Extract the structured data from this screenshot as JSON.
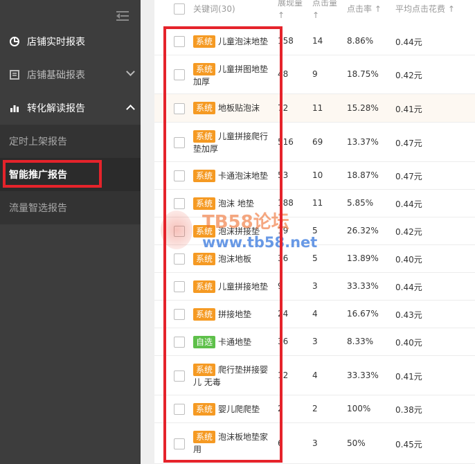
{
  "sidebar": {
    "items": [
      {
        "label": "店铺实时报表",
        "icon": "pie-chart-icon"
      },
      {
        "label": "店铺基础报表",
        "icon": "report-icon",
        "chevron": "down"
      },
      {
        "label": "转化解读报告",
        "icon": "bar-chart-icon",
        "chevron": "up"
      }
    ],
    "sub_items": [
      {
        "label": "定时上架报告",
        "active": false
      },
      {
        "label": "智能推广报告",
        "active": true
      },
      {
        "label": "流量智选报告",
        "active": false
      }
    ]
  },
  "table": {
    "headers": {
      "keyword": "关键词(30)",
      "impressions": "展现量",
      "clicks": "点击量",
      "ctr": "点击率",
      "avg_cost": "平均点击花费",
      "sort_arrow": "↑"
    },
    "rows": [
      {
        "tag": "系统",
        "tag_color": "#f59a23",
        "keyword": "儿童泡沫地垫",
        "impressions": "158",
        "clicks": "14",
        "ctr": "8.86%",
        "cost": "0.44元"
      },
      {
        "tag": "系统",
        "tag_color": "#f59a23",
        "keyword": "儿童拼图地垫加厚",
        "impressions": "48",
        "clicks": "9",
        "ctr": "18.75%",
        "cost": "0.42元"
      },
      {
        "tag": "系统",
        "tag_color": "#f59a23",
        "keyword": "地板贴泡沫",
        "impressions": "72",
        "clicks": "11",
        "ctr": "15.28%",
        "cost": "0.41元"
      },
      {
        "tag": "系统",
        "tag_color": "#f59a23",
        "keyword": "儿童拼接爬行垫加厚",
        "impressions": "516",
        "clicks": "69",
        "ctr": "13.37%",
        "cost": "0.47元"
      },
      {
        "tag": "系统",
        "tag_color": "#f59a23",
        "keyword": "卡通泡沫地垫",
        "impressions": "53",
        "clicks": "10",
        "ctr": "18.87%",
        "cost": "0.47元"
      },
      {
        "tag": "系统",
        "tag_color": "#f59a23",
        "keyword": "泡沫 地垫",
        "impressions": "188",
        "clicks": "11",
        "ctr": "5.85%",
        "cost": "0.44元"
      },
      {
        "tag": "系统",
        "tag_color": "#f59a23",
        "keyword": "泡沫拼接垫",
        "impressions": "19",
        "clicks": "5",
        "ctr": "26.32%",
        "cost": "0.42元"
      },
      {
        "tag": "系统",
        "tag_color": "#f59a23",
        "keyword": "泡沫地板",
        "impressions": "36",
        "clicks": "5",
        "ctr": "13.89%",
        "cost": "0.40元"
      },
      {
        "tag": "系统",
        "tag_color": "#f59a23",
        "keyword": "儿童拼接地垫",
        "impressions": "9",
        "clicks": "3",
        "ctr": "33.33%",
        "cost": "0.44元"
      },
      {
        "tag": "系统",
        "tag_color": "#f59a23",
        "keyword": "拼接地垫",
        "impressions": "24",
        "clicks": "4",
        "ctr": "16.67%",
        "cost": "0.43元"
      },
      {
        "tag": "自选",
        "tag_color": "#5ec04a",
        "keyword": "卡通地垫",
        "impressions": "36",
        "clicks": "3",
        "ctr": "8.33%",
        "cost": "0.40元"
      },
      {
        "tag": "系统",
        "tag_color": "#f59a23",
        "keyword": "爬行垫拼接婴儿 无毒",
        "impressions": "12",
        "clicks": "4",
        "ctr": "33.33%",
        "cost": "0.41元"
      },
      {
        "tag": "系统",
        "tag_color": "#f59a23",
        "keyword": "婴儿爬爬垫",
        "impressions": "2",
        "clicks": "2",
        "ctr": "100%",
        "cost": "0.38元"
      },
      {
        "tag": "系统",
        "tag_color": "#f59a23",
        "keyword": "泡沫板地垫家用",
        "impressions": "6",
        "clicks": "3",
        "ctr": "50%",
        "cost": "0.45元"
      }
    ]
  },
  "watermark": {
    "line1": "TB58论坛",
    "line2": "www.tb58.net"
  }
}
